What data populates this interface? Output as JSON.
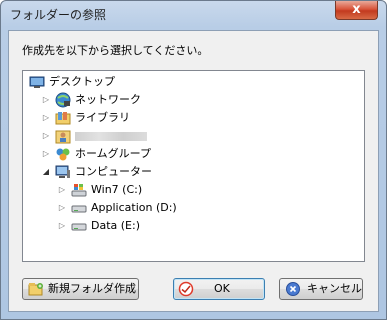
{
  "window": {
    "title": "フォルダーの参照",
    "close_glyph": "x"
  },
  "instruction": "作成先を以下から選択してください。",
  "tree": {
    "items": [
      {
        "label": "デスクトップ",
        "icon": "desktop-icon",
        "expander": ""
      },
      {
        "label": "ネットワーク",
        "icon": "network-icon",
        "expander": "▷"
      },
      {
        "label": "ライブラリ",
        "icon": "library-icon",
        "expander": "▷"
      },
      {
        "label": "",
        "icon": "user-folder-icon",
        "expander": "▷"
      },
      {
        "label": "ホームグループ",
        "icon": "homegroup-icon",
        "expander": "▷"
      },
      {
        "label": "コンピューター",
        "icon": "computer-icon",
        "expander": "◢"
      },
      {
        "label": "Win7 (C:)",
        "icon": "system-drive-icon",
        "expander": "▷"
      },
      {
        "label": "Application (D:)",
        "icon": "drive-icon",
        "expander": "▷"
      },
      {
        "label": "Data (E:)",
        "icon": "drive-icon",
        "expander": "▷"
      }
    ]
  },
  "buttons": {
    "new_folder": "新規フォルダ作成",
    "ok": "OK",
    "cancel": "キャンセル"
  },
  "colors": {
    "title_bar": "#b8cde6",
    "close_button": "#c23a1f",
    "dialog_face": "#f0f0f0",
    "default_button_border": "#3c7fb1"
  }
}
